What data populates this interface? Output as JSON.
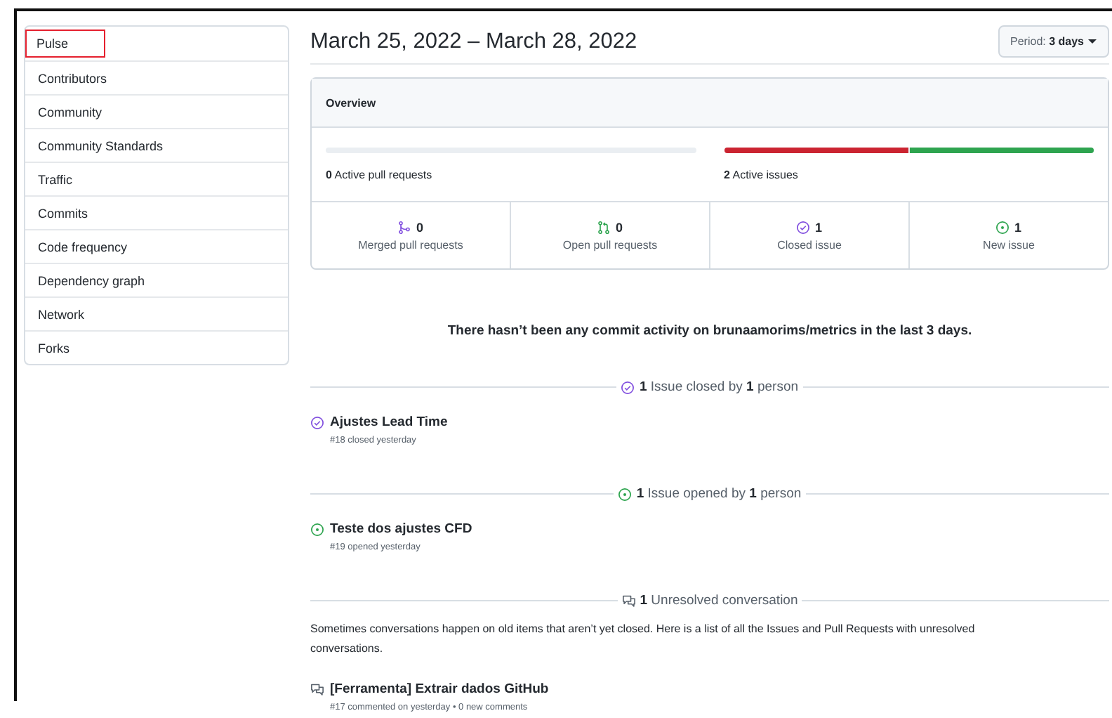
{
  "sidebar": {
    "items": [
      {
        "label": "Pulse",
        "selected": true
      },
      {
        "label": "Contributors",
        "selected": false
      },
      {
        "label": "Community",
        "selected": false
      },
      {
        "label": "Community Standards",
        "selected": false
      },
      {
        "label": "Traffic",
        "selected": false
      },
      {
        "label": "Commits",
        "selected": false
      },
      {
        "label": "Code frequency",
        "selected": false
      },
      {
        "label": "Dependency graph",
        "selected": false
      },
      {
        "label": "Network",
        "selected": false
      },
      {
        "label": "Forks",
        "selected": false
      }
    ]
  },
  "header": {
    "title": "March 25, 2022 – March 28, 2022",
    "period_button": "Period: **3 days**"
  },
  "overview": {
    "title": "Overview",
    "bars": [
      {
        "label": "**0** Active pull requests",
        "level": 0
      },
      {
        "label": "**2** Active issues",
        "segments": [
          {
            "level": 0.5,
            "color": "#cb2431"
          },
          {
            "level": 0.5,
            "color": "#2ea44f"
          }
        ]
      }
    ],
    "stats": [
      {
        "kind": "merged",
        "count": "0",
        "label": "Merged pull requests"
      },
      {
        "kind": "open-pr",
        "count": "0",
        "label": "Open pull requests"
      },
      {
        "kind": "closed",
        "count": "1",
        "label": "Closed issue"
      },
      {
        "kind": "new",
        "count": "1",
        "label": "New issue"
      }
    ]
  },
  "commit_message": "There hasn’t been any commit activity on brunaamorims/metrics in the last 3 days.",
  "sections": [
    {
      "kind": "closed",
      "heading": "**1** Issue closed by **1** person",
      "items": [
        {
          "kind": "closed",
          "title": "Ajustes Lead Time",
          "meta": "#18 closed yesterday"
        }
      ]
    },
    {
      "kind": "new",
      "heading": "**1** Issue opened by **1** person",
      "items": [
        {
          "kind": "new",
          "title": "Teste dos ajustes CFD",
          "meta": "#19 opened yesterday"
        }
      ]
    },
    {
      "kind": "conversation",
      "heading": "**1** Unresolved conversation",
      "description": "Sometimes conversations happen on old items that aren’t yet closed. Here is a list of all the Issues and Pull Requests with unresolved conversations.",
      "items": [
        {
          "kind": "conversation",
          "title": "[Ferramenta] Extrair dados GitHub",
          "meta": "#17 commented on yesterday • 0 new comments"
        }
      ]
    }
  ]
}
